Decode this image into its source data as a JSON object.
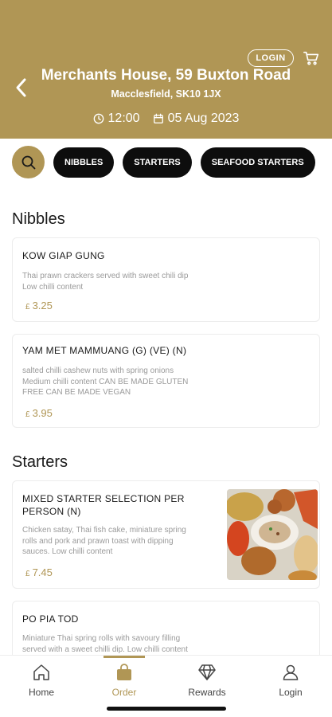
{
  "header": {
    "login_label": "LOGIN",
    "venue_name": "Merchants House, 59 Buxton Road",
    "venue_address": "Macclesfield, SK10 1JX",
    "time": "12:00",
    "date": "05 Aug 2023",
    "background_color": "#b09655",
    "icons": [
      "back-icon",
      "cart-icon",
      "clock-icon",
      "calendar-icon"
    ]
  },
  "categories": {
    "items": [
      "NIBBLES",
      "STARTERS",
      "SEAFOOD STARTERS"
    ]
  },
  "sections": [
    {
      "title": "Nibbles",
      "items": [
        {
          "name": "KOW GIAP GUNG",
          "desc_lines": [
            "Thai prawn crackers served with sweet chili dip",
            "Low chilli content"
          ],
          "currency": "£",
          "price": "3.25"
        },
        {
          "name": "YAM MET MAMMUANG (G) (VE) (N)",
          "desc_lines": [
            "salted chilli cashew nuts with spring onions",
            "Medium chilli content CAN BE MADE GLUTEN",
            "FREE CAN BE MADE VEGAN"
          ],
          "currency": "£",
          "price": "3.95"
        }
      ]
    },
    {
      "title": "Starters",
      "items": [
        {
          "name_lines": [
            "MIXED STARTER SELECTION PER",
            "PERSON (N)"
          ],
          "desc_lines": [
            "Chicken satay, Thai fish cake, miniature spring",
            "rolls and pork and prawn toast with dipping",
            "sauces. Low chilli content"
          ],
          "currency": "£",
          "price": "7.45",
          "has_image": true
        },
        {
          "name": "PO PIA TOD",
          "desc_lines": [
            "Miniature Thai spring rolls with savoury filling",
            "served with a sweet chilli dip. Low chilli content"
          ]
        }
      ]
    }
  ],
  "bottom_nav": {
    "items": [
      {
        "label": "Home",
        "icon": "home-icon"
      },
      {
        "label": "Order",
        "icon": "bag-icon",
        "active": true
      },
      {
        "label": "Rewards",
        "icon": "diamond-icon"
      },
      {
        "label": "Login",
        "icon": "user-icon"
      }
    ],
    "accent_color": "#b09655"
  }
}
